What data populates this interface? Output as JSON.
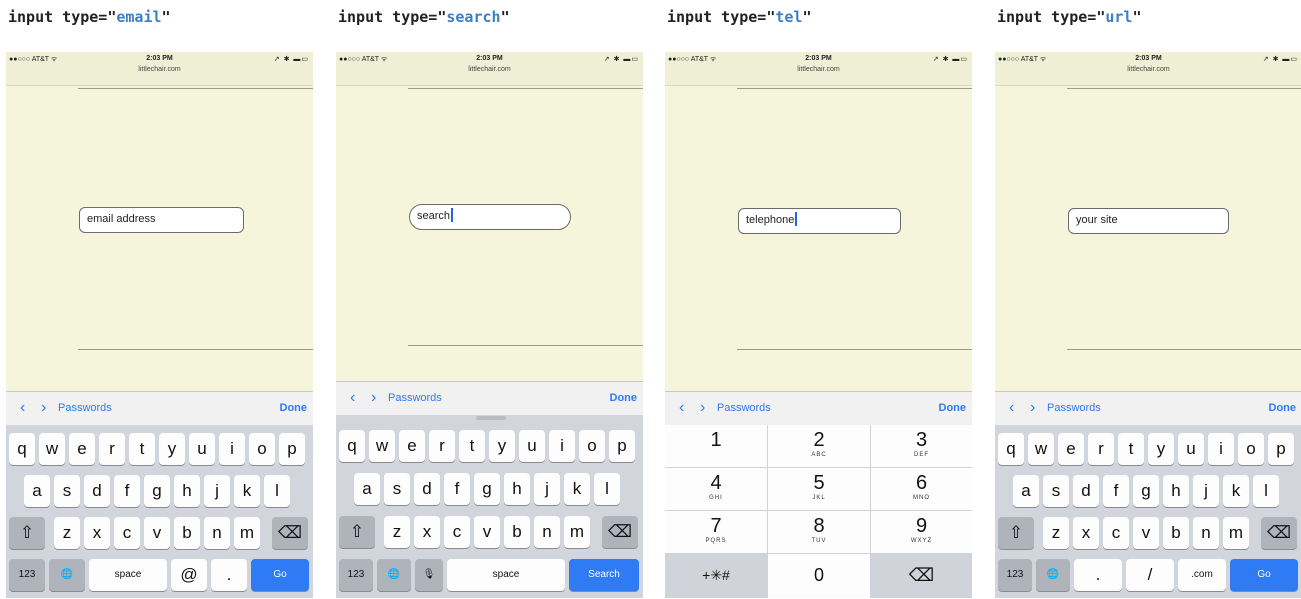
{
  "status": {
    "carrier": "●●○○○ AT&T ᯤ",
    "time": "2:03 PM",
    "url": "littlechair.com",
    "battery": "↗ ✱ ▬▭"
  },
  "accessory": {
    "prev": "‹",
    "next": "›",
    "passwords": "Passwords",
    "done": "Done"
  },
  "captions": [
    {
      "prefix": "input type=\"",
      "type": "email",
      "suffix": "\""
    },
    {
      "prefix": "input type=\"",
      "type": "search",
      "suffix": "\""
    },
    {
      "prefix": "input type=\"",
      "type": "tel",
      "suffix": "\""
    },
    {
      "prefix": "input type=\"",
      "type": "url",
      "suffix": "\""
    }
  ],
  "fields": {
    "email": "email address",
    "search": "search",
    "tel": "telephone",
    "url": "your site"
  },
  "keyboard": {
    "row1": [
      "q",
      "w",
      "e",
      "r",
      "t",
      "y",
      "u",
      "i",
      "o",
      "p"
    ],
    "row2": [
      "a",
      "s",
      "d",
      "f",
      "g",
      "h",
      "j",
      "k",
      "l"
    ],
    "row3": [
      "z",
      "x",
      "c",
      "v",
      "b",
      "n",
      "m"
    ],
    "shift": "⇧",
    "delete": "⌫",
    "numbers": "123",
    "globe": "🌐",
    "mic": "🎙",
    "space": "space",
    "at": "@",
    "dot": ".",
    "slash": "/",
    "dotcom": ".com",
    "go": "Go",
    "search": "Search"
  },
  "numpad": [
    {
      "digit": "1",
      "letters": ""
    },
    {
      "digit": "2",
      "letters": "ABC"
    },
    {
      "digit": "3",
      "letters": "DEF"
    },
    {
      "digit": "4",
      "letters": "GHI"
    },
    {
      "digit": "5",
      "letters": "JKL"
    },
    {
      "digit": "6",
      "letters": "MNO"
    },
    {
      "digit": "7",
      "letters": "PQRS"
    },
    {
      "digit": "8",
      "letters": "TUV"
    },
    {
      "digit": "9",
      "letters": "WXYZ"
    }
  ],
  "numpad_bottom": {
    "symbols": "+✳#",
    "zero": "0",
    "delete": "⌫"
  }
}
